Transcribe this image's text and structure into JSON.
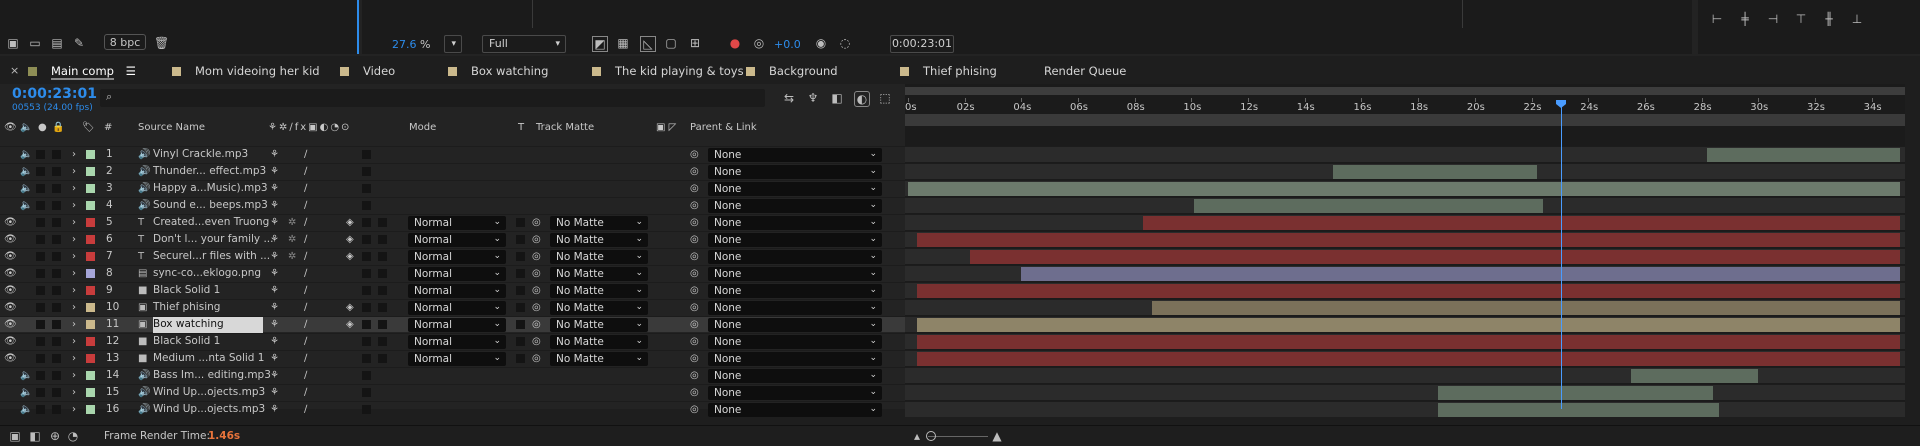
{
  "project_panel": {
    "bpc_label": "8 bpc"
  },
  "viewer": {
    "zoom_value": "27.6",
    "zoom_unit": "%",
    "resolution": "Full",
    "exposure": "+0.0",
    "timecode": "0:00:23:01"
  },
  "tabs": [
    {
      "label": "Main comp",
      "color": "#8e8e55",
      "active": true
    },
    {
      "label": "Mom videoing her kid",
      "color": "#cbb98c"
    },
    {
      "label": "Video",
      "color": "#cbb98c"
    },
    {
      "label": "Box watching",
      "color": "#cbb98c"
    },
    {
      "label": "The kid playing & toys",
      "color": "#cbb98c"
    },
    {
      "label": "Background",
      "color": "#cbb98c"
    },
    {
      "label": "Thief phising",
      "color": "#cbb98c"
    },
    {
      "label": "Render Queue",
      "color": ""
    }
  ],
  "timeline": {
    "current_time": "0:00:23:01",
    "frame_info": "00553 (24.00 fps)",
    "columns": {
      "hash": "#",
      "source_name": "Source Name",
      "mode": "Mode",
      "t": "T",
      "track_matte": "Track Matte",
      "parent_link": "Parent & Link"
    },
    "ruler": [
      "0s",
      "02s",
      "04s",
      "06s",
      "08s",
      "10s",
      "12s",
      "14s",
      "16s",
      "18s",
      "20s",
      "22s",
      "24s",
      "26s",
      "28s",
      "30s",
      "32s",
      "34s"
    ],
    "layers": [
      {
        "num": "1",
        "name": "Vinyl Crackle.mp3",
        "type": "audio",
        "label": "#a9d6ad",
        "mode": "",
        "matte": "",
        "parent": "None",
        "bar_color": "#5d6c5e",
        "bar_start": 28.2,
        "bar_end": 35.0
      },
      {
        "num": "2",
        "name": "Thunder... effect.mp3",
        "type": "audio",
        "label": "#a9d6ad",
        "mode": "",
        "matte": "",
        "parent": "None",
        "bar_color": "#5d6c5e",
        "bar_start": 15.0,
        "bar_end": 22.2
      },
      {
        "num": "3",
        "name": "Happy a...Music).mp3",
        "type": "audio",
        "label": "#a9d6ad",
        "mode": "",
        "matte": "",
        "parent": "None",
        "bar_color": "#6c7a6c",
        "bar_start": 0.0,
        "bar_end": 35.0
      },
      {
        "num": "4",
        "name": "Sound e... beeps.mp3",
        "type": "audio",
        "label": "#a9d6ad",
        "mode": "",
        "matte": "",
        "parent": "None",
        "bar_color": "#5d6c5e",
        "bar_start": 10.1,
        "bar_end": 22.4
      },
      {
        "num": "5",
        "name": "Created...even Truong",
        "type": "text",
        "label": "#c83c3c",
        "mode": "Normal",
        "matte": "No Matte",
        "parent": "None",
        "bar_color": "#7a3030",
        "bar_start": 8.3,
        "bar_end": 35.0
      },
      {
        "num": "6",
        "name": "Don't l... your family ...",
        "type": "text",
        "label": "#c83c3c",
        "mode": "Normal",
        "matte": "No Matte",
        "parent": "None",
        "bar_color": "#7a3030",
        "bar_start": 0.3,
        "bar_end": 35.0
      },
      {
        "num": "7",
        "name": "Securel...r files with ...",
        "type": "text",
        "label": "#c83c3c",
        "mode": "Normal",
        "matte": "No Matte",
        "parent": "None",
        "bar_color": "#7a3030",
        "bar_start": 2.2,
        "bar_end": 35.0
      },
      {
        "num": "8",
        "name": "sync-co...eklogo.png",
        "type": "image",
        "label": "#a5a5d8",
        "mode": "Normal",
        "matte": "No Matte",
        "parent": "None",
        "bar_color": "#6e6e8e",
        "bar_start": 4.0,
        "bar_end": 35.0
      },
      {
        "num": "9",
        "name": "Black Solid 1",
        "type": "solid",
        "label": "#c83c3c",
        "mode": "Normal",
        "matte": "No Matte",
        "parent": "None",
        "bar_color": "#7a3030",
        "bar_start": 0.3,
        "bar_end": 35.0
      },
      {
        "num": "10",
        "name": "Thief phising",
        "type": "comp",
        "label": "#cbb98c",
        "mode": "Normal",
        "matte": "No Matte",
        "parent": "None",
        "bar_color": "#7b715a",
        "bar_start": 8.6,
        "bar_end": 35.0
      },
      {
        "num": "11",
        "name": "Box watching",
        "type": "comp",
        "label": "#cbb98c",
        "mode": "Normal",
        "matte": "No Matte",
        "parent": "None",
        "bar_color": "#8e8468",
        "bar_start": 0.3,
        "bar_end": 35.0,
        "selected": true
      },
      {
        "num": "12",
        "name": "Black Solid 1",
        "type": "solid",
        "label": "#c83c3c",
        "mode": "Normal",
        "matte": "No Matte",
        "parent": "None",
        "bar_color": "#7a3030",
        "bar_start": 0.3,
        "bar_end": 35.0
      },
      {
        "num": "13",
        "name": "Medium ...nta Solid 1",
        "type": "solid",
        "label": "#c83c3c",
        "mode": "Normal",
        "matte": "No Matte",
        "parent": "None",
        "bar_color": "#7a3030",
        "bar_start": 0.3,
        "bar_end": 35.0
      },
      {
        "num": "14",
        "name": "Bass Im... editing.mp3",
        "type": "audio",
        "label": "#a9d6ad",
        "mode": "",
        "matte": "",
        "parent": "None",
        "bar_color": "#5d6c5e",
        "bar_start": 25.5,
        "bar_end": 30.0
      },
      {
        "num": "15",
        "name": "Wind Up...ojects.mp3",
        "type": "audio",
        "label": "#a9d6ad",
        "mode": "",
        "matte": "",
        "parent": "None",
        "bar_color": "#5d6c5e",
        "bar_start": 18.7,
        "bar_end": 28.4
      },
      {
        "num": "16",
        "name": "Wind Up...ojects.mp3",
        "type": "audio",
        "label": "#a9d6ad",
        "mode": "",
        "matte": "",
        "parent": "None",
        "bar_color": "#5d6c5e",
        "bar_start": 18.7,
        "bar_end": 28.6
      }
    ],
    "playhead_seconds": 23.04,
    "duration_seconds": 35
  },
  "status": {
    "render_label": "Frame Render Time:",
    "render_value": "1.46s",
    "render_color": "#e8743b"
  }
}
